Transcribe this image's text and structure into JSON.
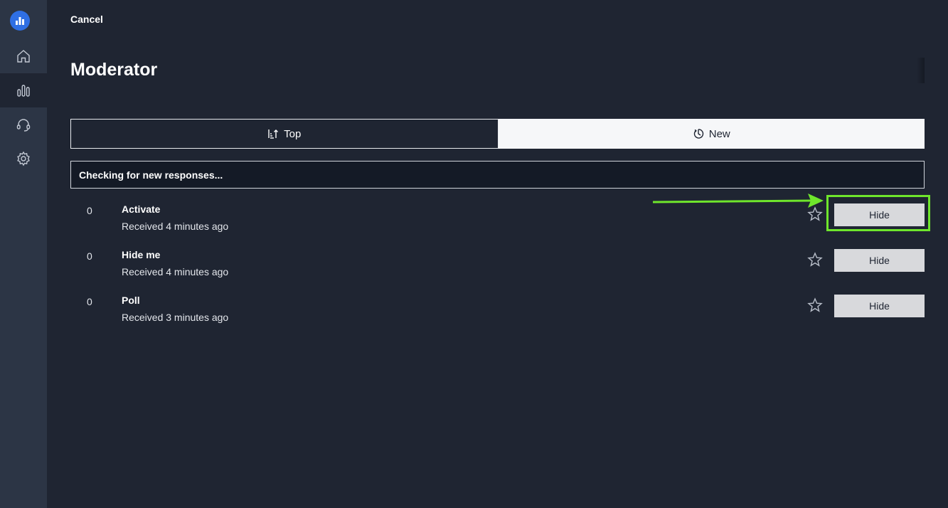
{
  "sidebar": {
    "logo": "mentimeter-logo-icon",
    "items": [
      {
        "name": "home",
        "icon": "home-icon",
        "active": false
      },
      {
        "name": "results",
        "icon": "bar-chart-icon",
        "active": true
      },
      {
        "name": "support",
        "icon": "headset-icon",
        "active": false
      },
      {
        "name": "settings",
        "icon": "gear-icon",
        "active": false
      }
    ]
  },
  "header": {
    "cancel_label": "Cancel",
    "title": "Moderator"
  },
  "tabs": [
    {
      "label": "Top",
      "icon": "sort-ascending-icon",
      "selected": false
    },
    {
      "label": "New",
      "icon": "clock-icon",
      "selected": true
    }
  ],
  "status": {
    "text": "Checking for new responses..."
  },
  "responses": [
    {
      "count": "0",
      "name": "Activate",
      "received": "Received 4 minutes ago",
      "hide_label": "Hide"
    },
    {
      "count": "0",
      "name": "Hide me",
      "received": "Received 4 minutes ago",
      "hide_label": "Hide"
    },
    {
      "count": "0",
      "name": "Poll",
      "received": "Received 3 minutes ago",
      "hide_label": "Hide"
    }
  ],
  "colors": {
    "background": "#1f2532",
    "sidebar": "#2c3545",
    "accent_logo": "#2f6fe4",
    "highlight": "#6fe62c",
    "button": "#d8d9dc"
  }
}
